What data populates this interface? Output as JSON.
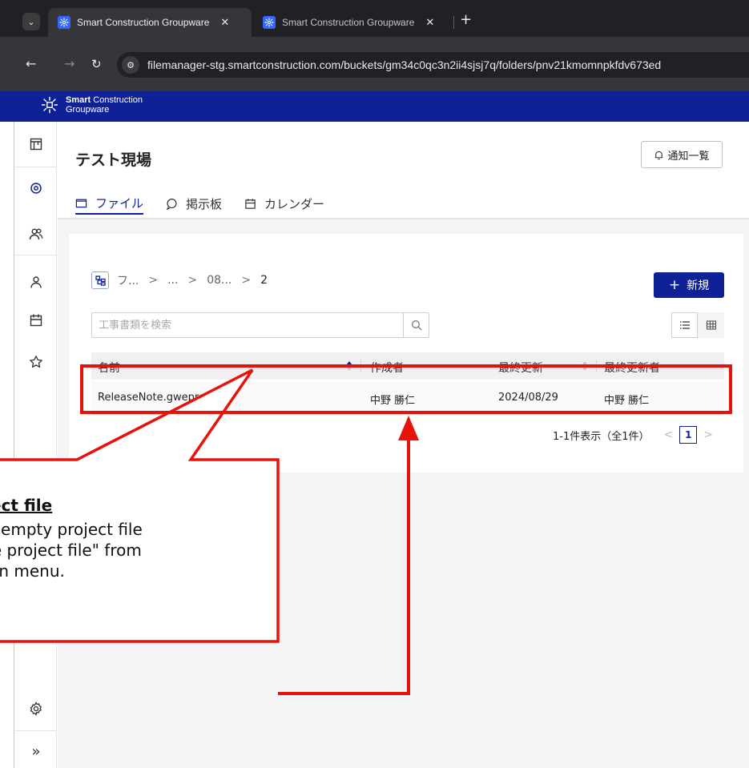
{
  "browser": {
    "tabs": [
      {
        "title": "Smart Construction Groupware",
        "active": true
      },
      {
        "title": "Smart Construction Groupware",
        "active": false
      }
    ],
    "url": "filemanager-stg.smartconstruction.com/buckets/gm34c0qc3n2ii4sjsj7q/folders/pnv21kmomnpkfdv673ed"
  },
  "app": {
    "logo_line1_bold": "Smart",
    "logo_line1_rest": " Construction",
    "logo_line2": "Groupware",
    "brand_color": "#0f2196"
  },
  "sidebar": {
    "items": [
      {
        "icon": "board-icon",
        "active": false
      },
      {
        "icon": "location-pin-icon",
        "active": true
      },
      {
        "icon": "users-icon",
        "active": false
      },
      {
        "icon": "user-icon",
        "active": false
      },
      {
        "icon": "calendar-icon",
        "active": false
      },
      {
        "icon": "star-icon",
        "active": false
      },
      {
        "icon": "settings-icon",
        "active": false
      },
      {
        "icon": "expand-icon",
        "active": false
      }
    ]
  },
  "page": {
    "title": "テスト現場",
    "notification_button": "通知一覧",
    "tabs": [
      {
        "label": "ファイル",
        "icon": "folder-icon",
        "active": true
      },
      {
        "label": "掲示板",
        "icon": "chat-icon",
        "active": false
      },
      {
        "label": "カレンダー",
        "icon": "calendar-icon",
        "active": false
      }
    ]
  },
  "files": {
    "breadcrumb": [
      "フ...",
      "...",
      "08...",
      "2"
    ],
    "new_button": "新規",
    "search_placeholder": "工事書類を検索",
    "columns": [
      "名前",
      "作成者",
      "最終更新",
      "最終更新者"
    ],
    "rows": [
      {
        "name": "ReleaseNote.gweproj",
        "creator": "中野 勝仁",
        "updated": "2024/08/29",
        "updater": "中野 勝仁"
      }
    ],
    "pagination_summary": "1-1件表示（全1件）",
    "current_page": "1"
  },
  "annotation": {
    "title": "ect file",
    "body": "n empty project file\nte project file\" from\nwn menu.",
    "color": "#e8120c"
  }
}
